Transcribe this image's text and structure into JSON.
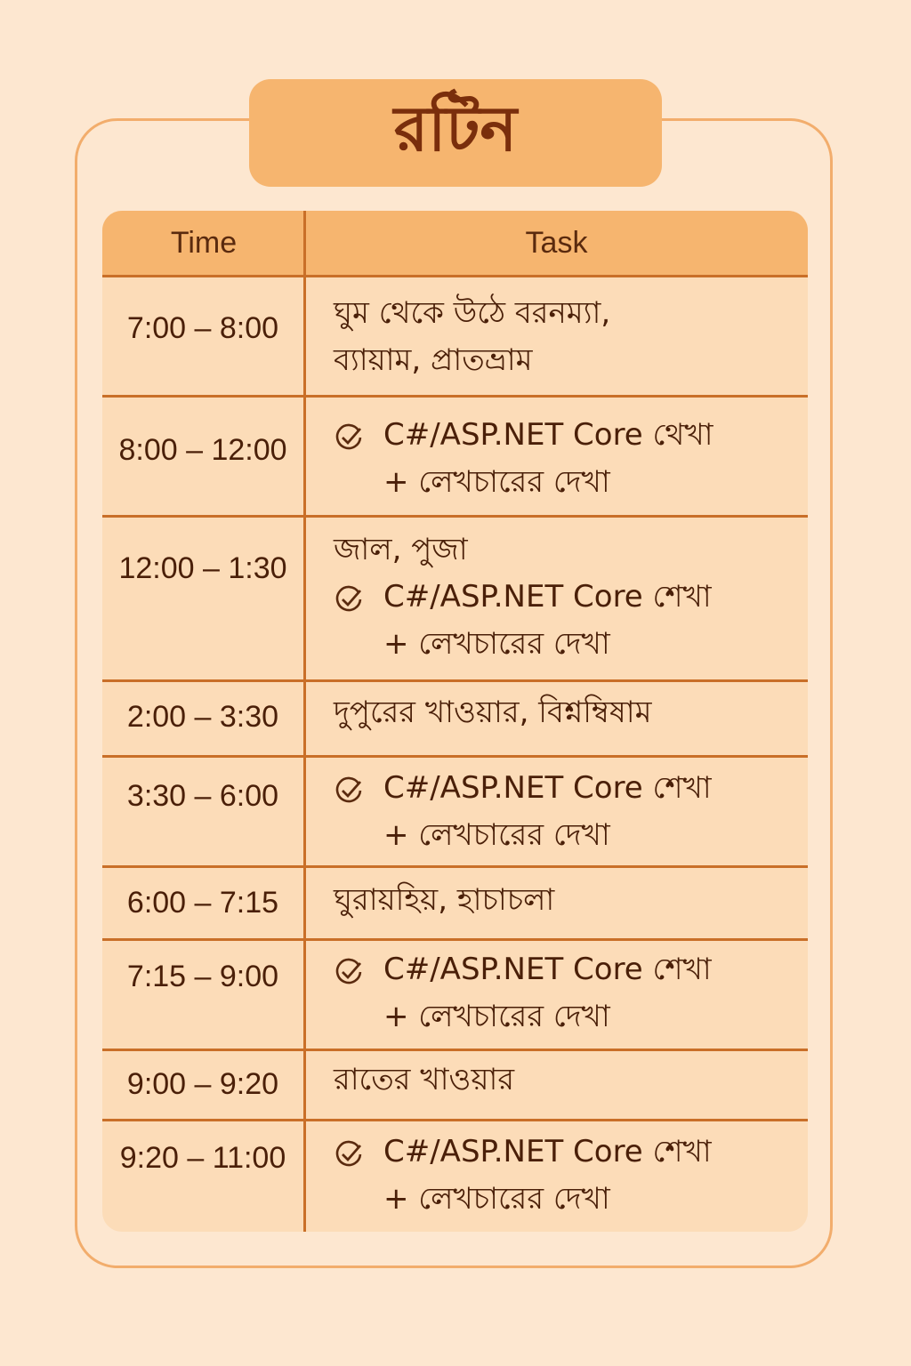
{
  "title": "রটিন",
  "header": {
    "time": "Time",
    "task": "Task"
  },
  "rows": [
    {
      "time": "7:00 – 8:00",
      "lines": [
        "ঘুম থেকে উঠে বরনম্যা,",
        "ব্যায়াম, প্রাতভ্রাম"
      ]
    },
    {
      "time": "8:00 – 12:00",
      "check": "C#/ASP.NET Core থেখা",
      "sub": "+ লেখচারের দেখা"
    },
    {
      "time": "12:00 – 1:30",
      "lines": [
        "জাল, পুজা"
      ],
      "check": "C#/ASP.NET Core শেখা",
      "sub": "+ লেখচারের দেখা"
    },
    {
      "time": "2:00 – 3:30",
      "lines": [
        "দুপুরের খাওয়ার, বিশ্নম্বিষাম"
      ]
    },
    {
      "time": "3:30 – 6:00",
      "check": "C#/ASP.NET Core শেখা",
      "sub": "+ লেখচারের দেখা"
    },
    {
      "time": "6:00 – 7:15",
      "lines": [
        "ঘুরায়হিয়, হাচাচলা"
      ]
    },
    {
      "time": "7:15 – 9:00",
      "check": "C#/ASP.NET Core শেখা",
      "sub": "+ লেখচারের দেখা"
    },
    {
      "time": "9:00 – 9:20",
      "lines": [
        "রাতের খাওয়ার"
      ]
    },
    {
      "time": "9:20 – 11:00",
      "check": "C#/ASP.NET Core শেখা",
      "sub": "+ লেখচারের দেখা"
    }
  ],
  "icons": {
    "check": "check-circle-icon"
  },
  "colors": {
    "background": "#fde7d0",
    "accent": "#f6b56f",
    "divider": "#c96f28",
    "text": "#4a1f08"
  }
}
